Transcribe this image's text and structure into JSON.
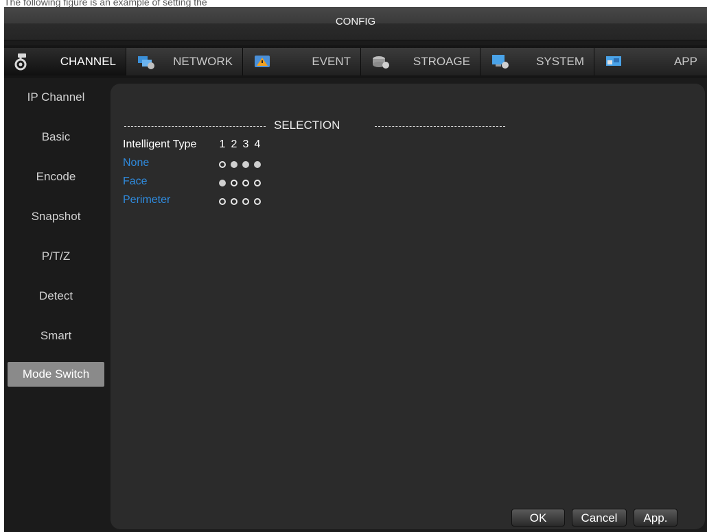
{
  "page": {
    "caption": "The following figure is an example of setting the intelligent type:"
  },
  "window": {
    "title": "CONFIG"
  },
  "tabs": [
    {
      "label": "CHANNEL",
      "icon": "channel-gear-icon",
      "active": true
    },
    {
      "label": "NETWORK",
      "icon": "network-icon"
    },
    {
      "label": "EVENT",
      "icon": "event-icon"
    },
    {
      "label": "STROAGE",
      "icon": "storage-icon"
    },
    {
      "label": "SYSTEM",
      "icon": "system-icon"
    },
    {
      "label": "APP",
      "icon": "app-icon"
    }
  ],
  "sidebar": {
    "items": [
      {
        "label": "IP Channel"
      },
      {
        "label": "Basic"
      },
      {
        "label": "Encode"
      },
      {
        "label": "Snapshot"
      },
      {
        "label": "P/T/Z"
      },
      {
        "label": "Detect"
      },
      {
        "label": "Smart"
      },
      {
        "label": "Mode Switch",
        "active": true
      }
    ]
  },
  "selection": {
    "title": "SELECTION",
    "header": "Intelligent Type",
    "channels": [
      "1",
      "2",
      "3",
      "4"
    ],
    "rows": [
      {
        "label": "None",
        "selected": [
          false,
          true,
          true,
          true
        ]
      },
      {
        "label": "Face",
        "selected": [
          true,
          false,
          false,
          false
        ]
      },
      {
        "label": "Perimeter",
        "selected": [
          false,
          false,
          false,
          false
        ]
      }
    ]
  },
  "buttons": {
    "ok": "OK",
    "cancel": "Cancel",
    "apply": "App."
  },
  "colors": {
    "accent_text": "#2f8bde",
    "active_item_bg": "#8a8a8a",
    "panel_bg": "#2b2b2b"
  }
}
